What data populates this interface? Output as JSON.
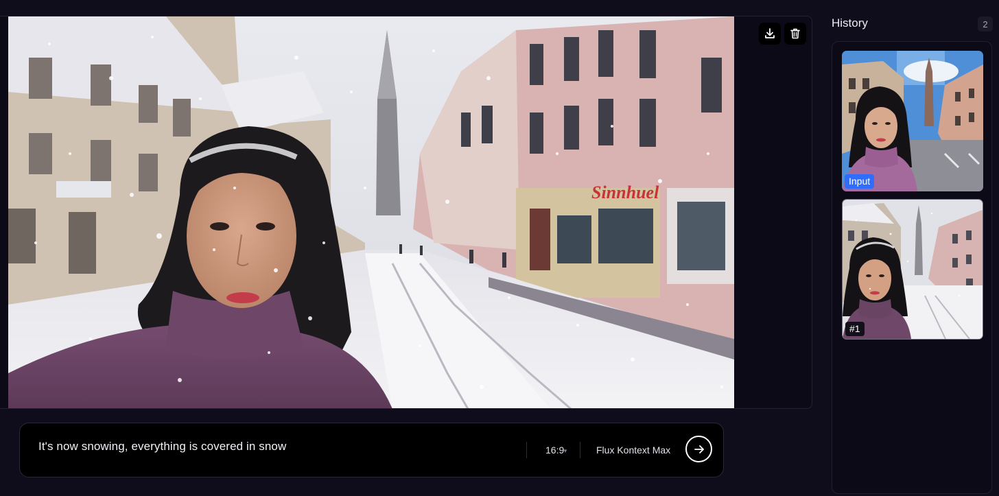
{
  "canvas": {
    "image_description": "Woman in a purple knit turtleneck taking a selfie on a snow-covered European street with a tall church spire in the background",
    "toolbar": {
      "download_icon": "download-icon",
      "delete_icon": "trash-icon"
    },
    "storefront_sign": "Sinnhuel"
  },
  "prompt": {
    "text": "It's now snowing, everything is covered in snow",
    "aspect_ratio": "16:9",
    "model": "Flux Kontext Max",
    "submit_icon": "arrow-right-icon"
  },
  "history": {
    "title": "History",
    "count": "2",
    "items": [
      {
        "badge": "Input",
        "badge_color": "#2f6dff",
        "variant": "sunny street"
      },
      {
        "badge": "#1",
        "badge_color": "#121018",
        "variant": "snowy street"
      }
    ]
  },
  "colors": {
    "background": "#0f0d1c",
    "panel": "#0c0a17",
    "accent": "#2f6dff"
  }
}
